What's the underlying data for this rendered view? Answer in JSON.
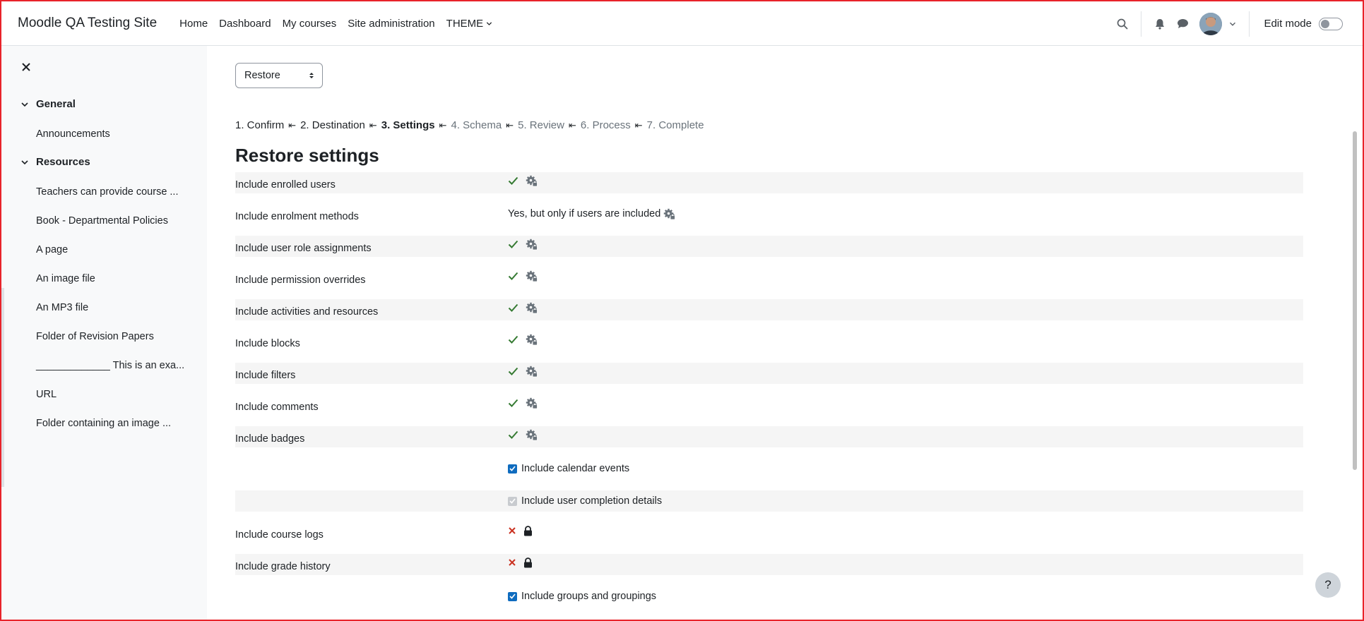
{
  "site": {
    "name": "Moodle QA Testing Site"
  },
  "nav": {
    "items": [
      {
        "label": "Home"
      },
      {
        "label": "Dashboard"
      },
      {
        "label": "My courses"
      },
      {
        "label": "Site administration"
      },
      {
        "label": "THEME"
      }
    ],
    "edit_mode_label": "Edit mode"
  },
  "drawer": {
    "sections": [
      {
        "title": "General",
        "items": [
          "Announcements"
        ]
      },
      {
        "title": "Resources",
        "items": [
          "Teachers can provide course ...",
          "Book - Departmental Policies",
          "A page",
          "An image file",
          "An MP3 file",
          "Folder of Revision Papers",
          "_____________ This is an exa...",
          "URL",
          "Folder containing an image ..."
        ]
      }
    ]
  },
  "restore": {
    "select_value": "Restore",
    "steps": [
      {
        "label": "1. Confirm",
        "state": "done"
      },
      {
        "label": "2. Destination",
        "state": "done"
      },
      {
        "label": "3. Settings",
        "state": "current"
      },
      {
        "label": "4. Schema",
        "state": "future"
      },
      {
        "label": "5. Review",
        "state": "future"
      },
      {
        "label": "6. Process",
        "state": "future"
      },
      {
        "label": "7. Complete",
        "state": "future"
      }
    ],
    "step_separator": "⇤",
    "title": "Restore settings",
    "settings": [
      {
        "label": "Include enrolled users",
        "value": "check-gear"
      },
      {
        "label": "Include enrolment methods",
        "value_text": "Yes, but only if users are included"
      },
      {
        "label": "Include user role assignments",
        "value": "check-gear"
      },
      {
        "label": "Include permission overrides",
        "value": "check-gear"
      },
      {
        "label": "Include activities and resources",
        "value": "check-gear"
      },
      {
        "label": "Include blocks",
        "value": "check-gear"
      },
      {
        "label": "Include filters",
        "value": "check-gear"
      },
      {
        "label": "Include comments",
        "value": "check-gear"
      },
      {
        "label": "Include badges",
        "value": "check-gear"
      },
      {
        "label": "",
        "checkbox_label": "Include calendar events",
        "checked": true,
        "disabled": false
      },
      {
        "label": "",
        "checkbox_label": "Include user completion details",
        "checked": true,
        "disabled": true
      },
      {
        "label": "Include course logs",
        "value": "cross-lock"
      },
      {
        "label": "Include grade history",
        "value": "cross-lock"
      },
      {
        "label": "",
        "checkbox_label": "Include groups and groupings",
        "checked": true,
        "disabled": false
      }
    ]
  },
  "help": {
    "label": "?"
  },
  "colors": {
    "check": "#357a32",
    "cross": "#ca3120",
    "gear": "#6a737b",
    "accent": "#0f6cbf"
  }
}
